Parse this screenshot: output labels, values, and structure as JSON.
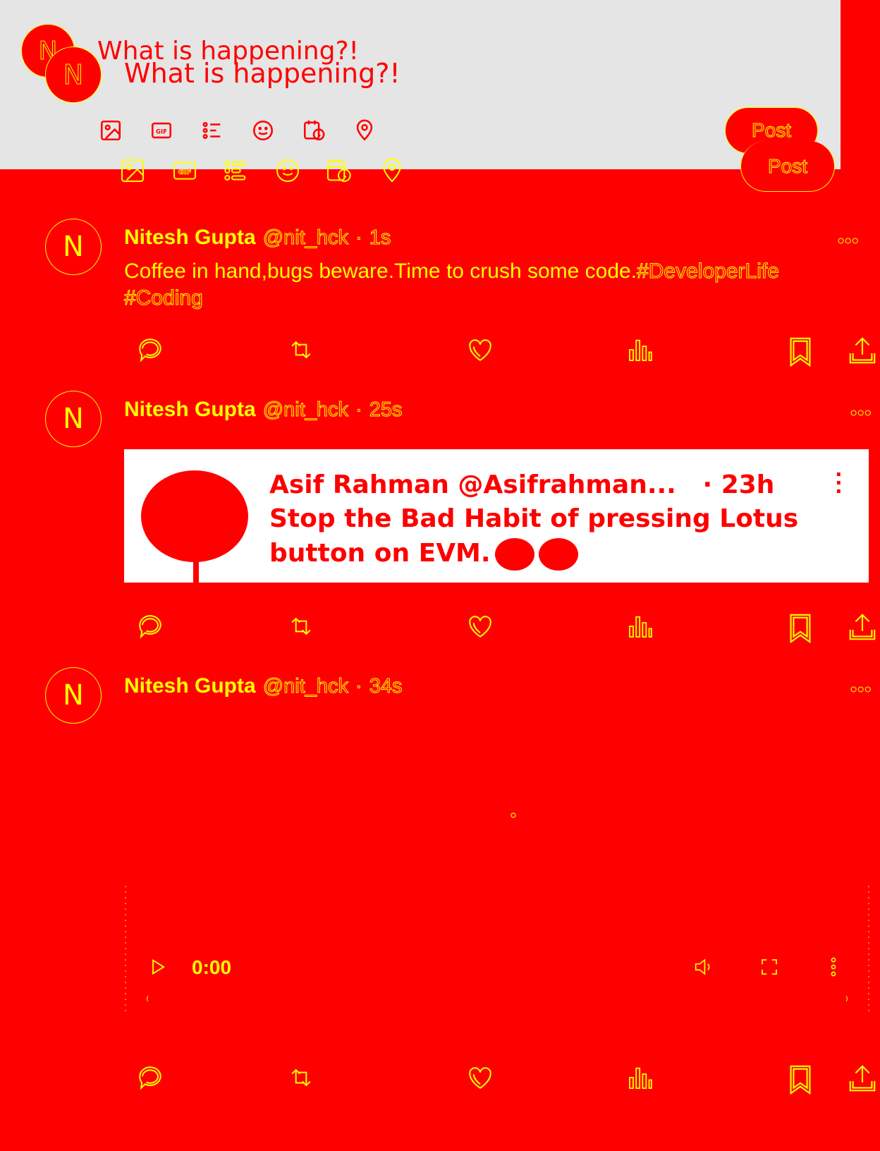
{
  "composer": {
    "avatar_initial": "N",
    "placeholder": "What is happening?!",
    "toolbar_icons": [
      "image-icon",
      "gif-icon",
      "poll-icon",
      "emoji-icon",
      "schedule-icon",
      "location-icon"
    ],
    "post_label": "Post"
  },
  "tweets": [
    {
      "avatar_initial": "N",
      "name": "Nitesh Gupta",
      "handle": "@nit_hck",
      "time": "1s",
      "text": "Coffee in hand,bugs beware.Time to crush some code.",
      "hashtags": [
        "#DeveloperLife",
        "#Coding"
      ]
    },
    {
      "avatar_initial": "N",
      "name": "Nitesh Gupta",
      "handle": "@nit_hck",
      "time": "25s",
      "quote": {
        "author": "Asif Rahman @Asifrahman...",
        "time": "· 23h",
        "line1": "Stop the Bad Habit of pressing Lotus",
        "line2": "button on EVM."
      }
    },
    {
      "avatar_initial": "N",
      "name": "Nitesh Gupta",
      "handle": "@nit_hck",
      "time": "34s",
      "video": {
        "time": "0:00"
      }
    }
  ],
  "meta_sep": "·",
  "more_label": "•••",
  "action_icons": [
    "reply-icon",
    "retweet-icon",
    "like-icon",
    "views-icon",
    "bookmark-icon",
    "share-icon"
  ],
  "colors": {
    "background": "#ff0000",
    "foreground": "#ffff00",
    "composer": "#e5e5e5",
    "quote_bg": "#ffffff"
  }
}
